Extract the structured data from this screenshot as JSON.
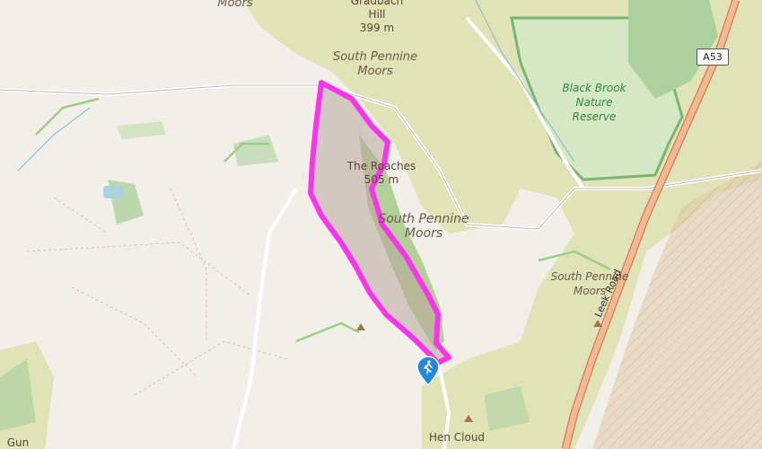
{
  "map": {
    "labels": {
      "moors_top": "Moors",
      "gradbach_name": "Gradbach",
      "gradbach_hill": "Hill",
      "gradbach_height": "399 m",
      "spm1_line1": "South Pennine",
      "spm1_line2": "Moors",
      "roaches_name": "The Roaches",
      "roaches_height": "505 m",
      "spm2_line1": "South Pennine",
      "spm2_line2": "Moors",
      "spm3_line1": "South Pennine",
      "spm3_line2": "Moors",
      "nature_line1": "Black Brook",
      "nature_line2": "Nature",
      "nature_line3": "Reserve",
      "road_shield": "A53",
      "road_name": "Leek Road",
      "hen_cloud": "Hen Cloud",
      "gun": "Gun"
    },
    "colors": {
      "background": "#f2efe9",
      "moorland": "#dfe3b6",
      "route": "#ff33ee",
      "nature_reserve_border": "#6cb36c",
      "forest": "#add19e",
      "road_major": "#f49a78",
      "quarry_hatched": "#c8a88a",
      "walker_pin": "#1e88e5"
    },
    "icons": {
      "start_marker": "hiker-pin-icon",
      "peak_marker": "peak-triangle-icon"
    }
  }
}
